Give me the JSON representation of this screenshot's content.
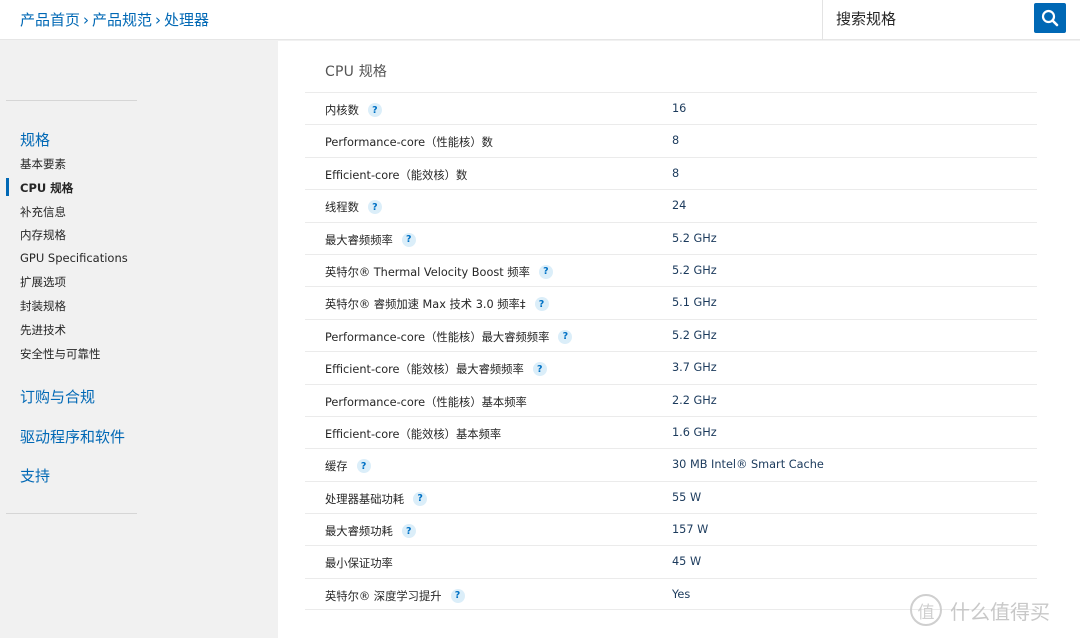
{
  "header": {
    "breadcrumb": [
      "产品首页",
      "产品规范",
      "处理器"
    ],
    "breadcrumb_sep": "›",
    "search_placeholder": "搜索规格"
  },
  "sidebar": {
    "section1": "规格",
    "items": [
      "基本要素",
      "CPU 规格",
      "补充信息",
      "内存规格",
      "GPU Specifications",
      "扩展选项",
      "封装规格",
      "先进技术",
      "安全性与可靠性"
    ],
    "active_index": 1,
    "section2": "订购与合规",
    "section3": "驱动程序和软件",
    "section4": "支持"
  },
  "main": {
    "title": "CPU 规格",
    "rows": [
      {
        "label": "内核数",
        "value": "16",
        "help": true
      },
      {
        "label": "Performance-core（性能核）数",
        "value": "8",
        "help": false
      },
      {
        "label": "Efficient-core（能效核）数",
        "value": "8",
        "help": false
      },
      {
        "label": "线程数",
        "value": "24",
        "help": true
      },
      {
        "label": "最大睿频频率",
        "value": "5.2 GHz",
        "help": true
      },
      {
        "label": "英特尔® Thermal Velocity Boost 频率",
        "value": "5.2 GHz",
        "help": true
      },
      {
        "label": "英特尔® 睿频加速 Max 技术 3.0 频率‡",
        "value": "5.1 GHz",
        "help": true
      },
      {
        "label": "Performance-core（性能核）最大睿频频率",
        "value": "5.2 GHz",
        "help": true
      },
      {
        "label": "Efficient-core（能效核）最大睿频频率",
        "value": "3.7 GHz",
        "help": true
      },
      {
        "label": "Performance-core（性能核）基本频率",
        "value": "2.2 GHz",
        "help": false
      },
      {
        "label": "Efficient-core（能效核）基本频率",
        "value": "1.6 GHz",
        "help": false
      },
      {
        "label": "缓存",
        "value": "30 MB Intel® Smart Cache",
        "help": true
      },
      {
        "label": "处理器基础功耗",
        "value": "55 W",
        "help": true
      },
      {
        "label": "最大睿频功耗",
        "value": "157 W",
        "help": true
      },
      {
        "label": "最小保证功率",
        "value": "45 W",
        "help": false
      },
      {
        "label": "英特尔® 深度学习提升",
        "value": "Yes",
        "help": true
      }
    ],
    "help_glyph": "?"
  },
  "watermark": {
    "logo": "值",
    "text": "什么值得买"
  },
  "colors": {
    "accent": "#0068b5",
    "value_text": "#1b3a5c"
  }
}
